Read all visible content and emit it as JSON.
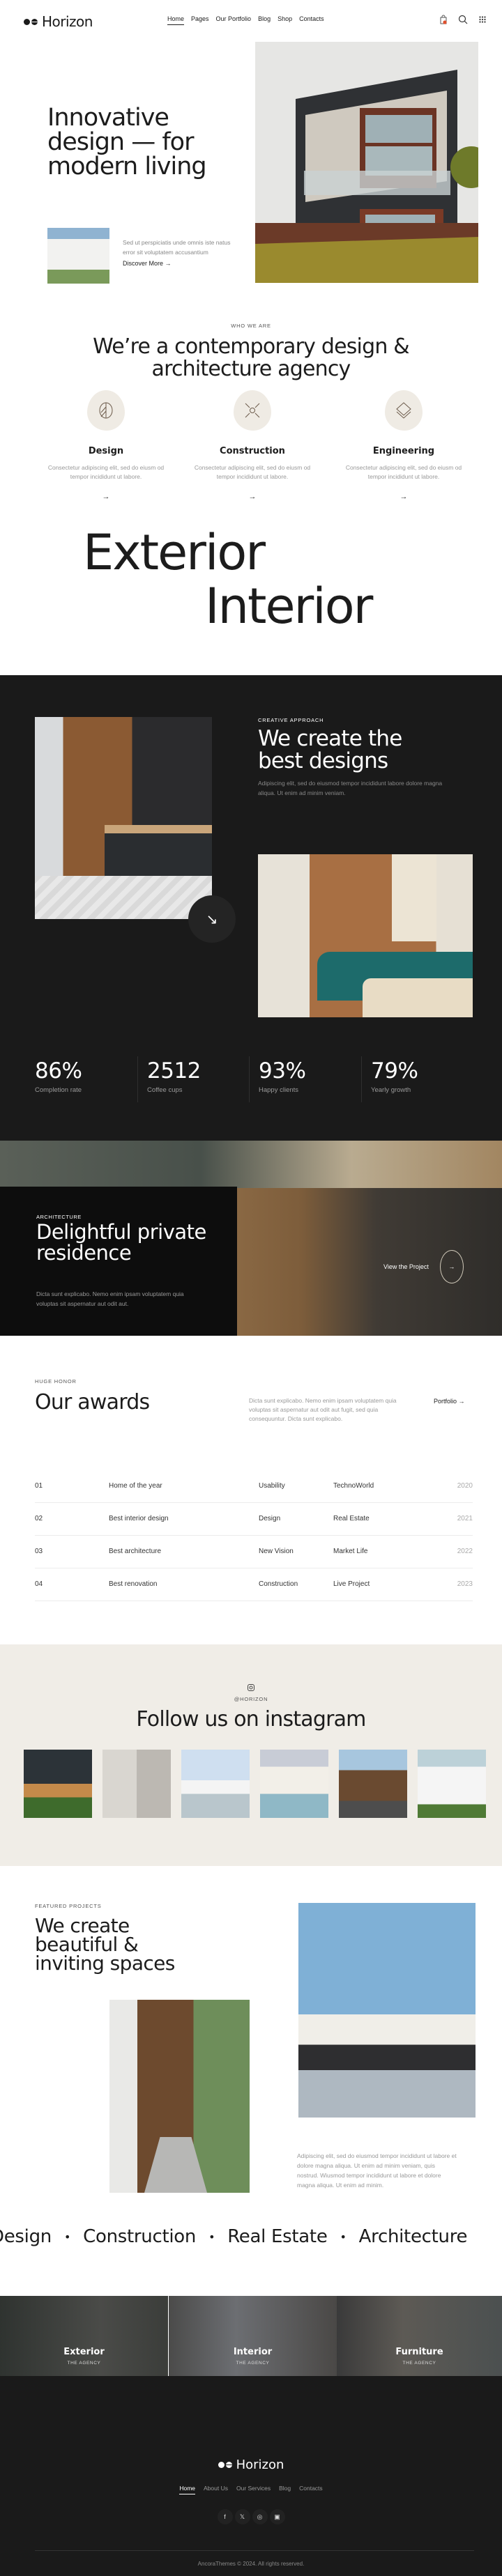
{
  "header": {
    "brand": "Horizon",
    "nav": [
      "Home",
      "Pages",
      "Our Portfolio",
      "Blog",
      "Shop",
      "Contacts"
    ],
    "active_nav": "Home",
    "cart_count": "0",
    "icons": [
      "cart-icon",
      "search-icon",
      "grid-menu-icon"
    ]
  },
  "hero": {
    "title_lines": [
      "Innovative",
      "design — for",
      "modern living"
    ],
    "description": "Sed ut perspiciatis unde omnis iste natus error sit voluptatem accusantium",
    "cta": "Discover More"
  },
  "who": {
    "eyebrow": "WHO WE ARE",
    "title_lines": [
      "We’re a contemporary design &",
      "architecture agency"
    ],
    "services": [
      {
        "title": "Design",
        "text": "Consectetur adipiscing elit, sed do eiusm od tempor incididunt ut labore.",
        "icon": "leaf-shape-icon"
      },
      {
        "title": "Construction",
        "text": "Consectetur adipiscing elit, sed do eiusm od tempor incididunt ut labore.",
        "icon": "converging-arrows-icon"
      },
      {
        "title": "Engineering",
        "text": "Consectetur adipiscing elit, sed do eiusm od tempor incididunt ut labore.",
        "icon": "layers-icon"
      }
    ]
  },
  "big_words": [
    "Exterior",
    "Interior"
  ],
  "creative": {
    "eyebrow": "CREATIVE APPROACH",
    "title_lines": [
      "We create the",
      "best designs"
    ],
    "description": "Adipiscing elit, sed do eiusmod tempor incididunt labore dolore magna aliqua. Ut enim ad minim veniam."
  },
  "stats": [
    {
      "value": "86%",
      "label": "Completion rate"
    },
    {
      "value": "2512",
      "label": "Coffee cups"
    },
    {
      "value": "93%",
      "label": "Happy clients"
    },
    {
      "value": "79%",
      "label": "Yearly growth"
    }
  ],
  "residence": {
    "eyebrow": "ARCHITECTURE",
    "title_lines": [
      "Delightful private",
      "residence"
    ],
    "description": "Dicta sunt explicabo. Nemo enim ipsam voluptatem quia voluptas sit aspernatur aut odit aut.",
    "cta": "View the Project"
  },
  "awards": {
    "eyebrow": "HUGE HONOR",
    "title": "Our awards",
    "description": "Dicta sunt explicabo. Nemo enim ipsam voluptatem quia voluptas sit aspernatur aut odit aut fugit, sed quia consequuntur. Dicta sunt explicabo.",
    "link": "Portfolio →",
    "rows": [
      {
        "num": "01",
        "award": "Home of the year",
        "type": "Usability",
        "org": "TechnoWorld",
        "year": "2020"
      },
      {
        "num": "02",
        "award": "Best interior design",
        "type": "Design",
        "org": "Real Estate",
        "year": "2021"
      },
      {
        "num": "03",
        "award": "Best architecture",
        "type": "New Vision",
        "org": "Market Life",
        "year": "2022"
      },
      {
        "num": "04",
        "award": "Best renovation",
        "type": "Construction",
        "org": "Live Project",
        "year": "2023"
      }
    ]
  },
  "instagram": {
    "handle": "@HORIZON",
    "title": "Follow us on instagram",
    "photos": 6
  },
  "featured": {
    "eyebrow": "FEATURED PROJECTS",
    "title_lines": [
      "We create",
      "beautiful &",
      "inviting spaces"
    ],
    "description": "Adipiscing elit, sed do eiusmod tempor incididunt ut labore et dolore magna aliqua. Ut enim ad minim veniam, quis nostrud. Wiusmod tempor incididunt ut labore et dolore magna aliqua. Ut enim ad minim."
  },
  "marquee": [
    "Design",
    "Construction",
    "Real Estate",
    "Architecture"
  ],
  "categories": [
    {
      "title": "Exterior",
      "subtitle": "THE AGENCY"
    },
    {
      "title": "Interior",
      "subtitle": "THE AGENCY"
    },
    {
      "title": "Furniture",
      "subtitle": "THE AGENCY"
    }
  ],
  "footer": {
    "brand": "Horizon",
    "nav": [
      "Home",
      "About Us",
      "Our Services",
      "Blog",
      "Contacts"
    ],
    "social": [
      "facebook-icon",
      "x-icon",
      "dribbble-icon",
      "instagram-icon"
    ],
    "copyright": "AncoraThemes © 2024. All rights reserved."
  },
  "colors": {
    "dark_bg": "#1a1a1a",
    "beige_bg": "#f0ede7",
    "text": "#1c1c1c",
    "accent_badge": "#e0502e"
  }
}
